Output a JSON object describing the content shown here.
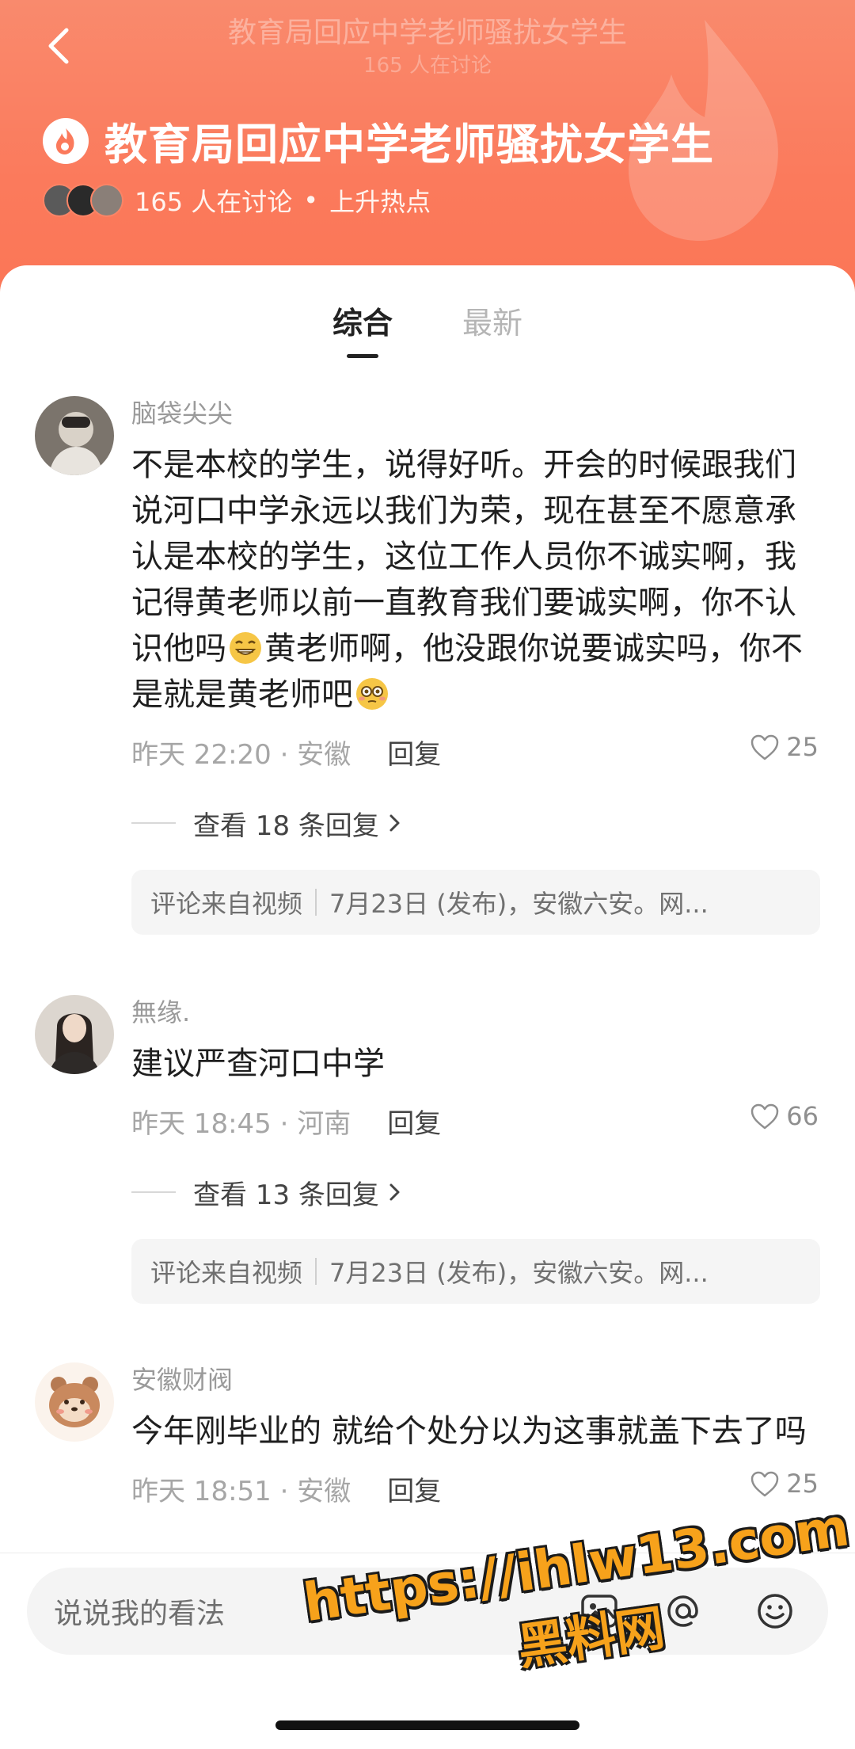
{
  "nav": {
    "title": "教育局回应中学老师骚扰女学生",
    "subtitle": "165 人在讨论"
  },
  "topic": {
    "title": "教育局回应中学老师骚扰女学生",
    "participants": "165 人在讨论",
    "separator": "•",
    "tag": "上升热点"
  },
  "tabs": [
    {
      "label": "综合",
      "active": true
    },
    {
      "label": "最新",
      "active": false
    }
  ],
  "comments": [
    {
      "user": "脑袋尖尖",
      "text_1": "不是本校的学生，说得好听。开会的时候跟我们说河口中学永远以我们为荣，现在甚至不愿意承认是本校的学生，这位工作人员你不诚实啊，我记得黄老师以前一直教育我们要诚实啊，你不认识他吗",
      "text_2": "黄老师啊，他没跟你说要诚实吗，你不是就是黄老师吧",
      "meta": "昨天 22:20 · 安徽",
      "reply": "回复",
      "likes": "25",
      "view_replies": "查看 18 条回复",
      "source_a": "评论来自视频",
      "source_b": "7月23日 (发布)，安徽六安。网..."
    },
    {
      "user": "無缘.",
      "text_1": "建议严查河口中学",
      "meta": "昨天 18:45 · 河南",
      "reply": "回复",
      "likes": "66",
      "view_replies": "查看 13 条回复",
      "source_a": "评论来自视频",
      "source_b": "7月23日 (发布)，安徽六安。网..."
    },
    {
      "user": "安徽财阀",
      "text_1": "今年刚毕业的 就给个处分以为这事就盖下去了吗",
      "meta": "昨天 18:51 · 安徽",
      "reply": "回复",
      "likes": "25"
    }
  ],
  "input": {
    "placeholder": "说说我的看法"
  },
  "watermark": {
    "url": "https://ihlw13.com",
    "name": "黑料网"
  },
  "colors": {
    "header": "#fb7a5c",
    "watermark": "#f7a21b"
  }
}
